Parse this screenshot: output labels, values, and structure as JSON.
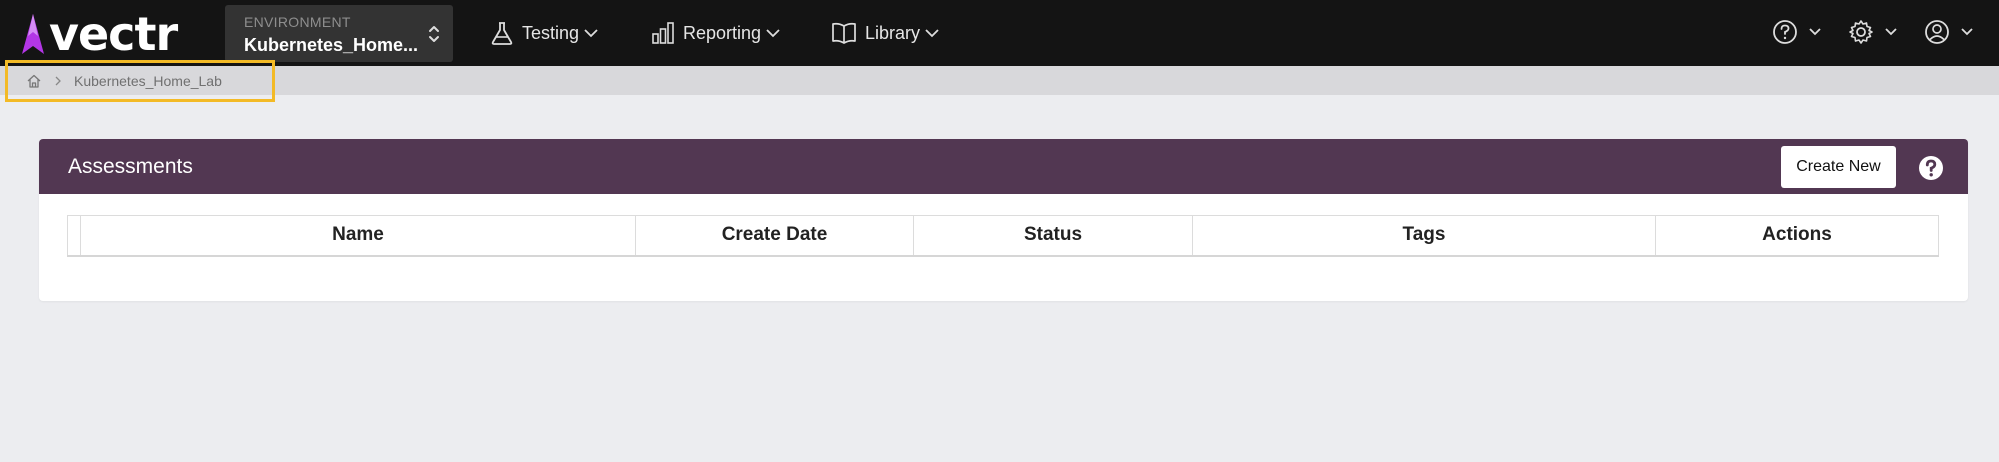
{
  "brand": {
    "name": "vectr",
    "accent": "#b336e6"
  },
  "environment": {
    "label": "ENVIRONMENT",
    "value": "Kubernetes_Home..."
  },
  "nav": [
    {
      "label": "Testing",
      "icon": "flask-icon"
    },
    {
      "label": "Reporting",
      "icon": "bar-chart-icon"
    },
    {
      "label": "Library",
      "icon": "book-icon"
    }
  ],
  "breadcrumb": {
    "home_icon": "home-icon",
    "current": "Kubernetes_Home_Lab"
  },
  "assessments": {
    "title": "Assessments",
    "create_label": "Create New",
    "columns": [
      "Name",
      "Create Date",
      "Status",
      "Tags",
      "Actions"
    ]
  },
  "colors": {
    "topbar": "#141414",
    "header": "#523752",
    "highlight": "#f3ba26"
  }
}
